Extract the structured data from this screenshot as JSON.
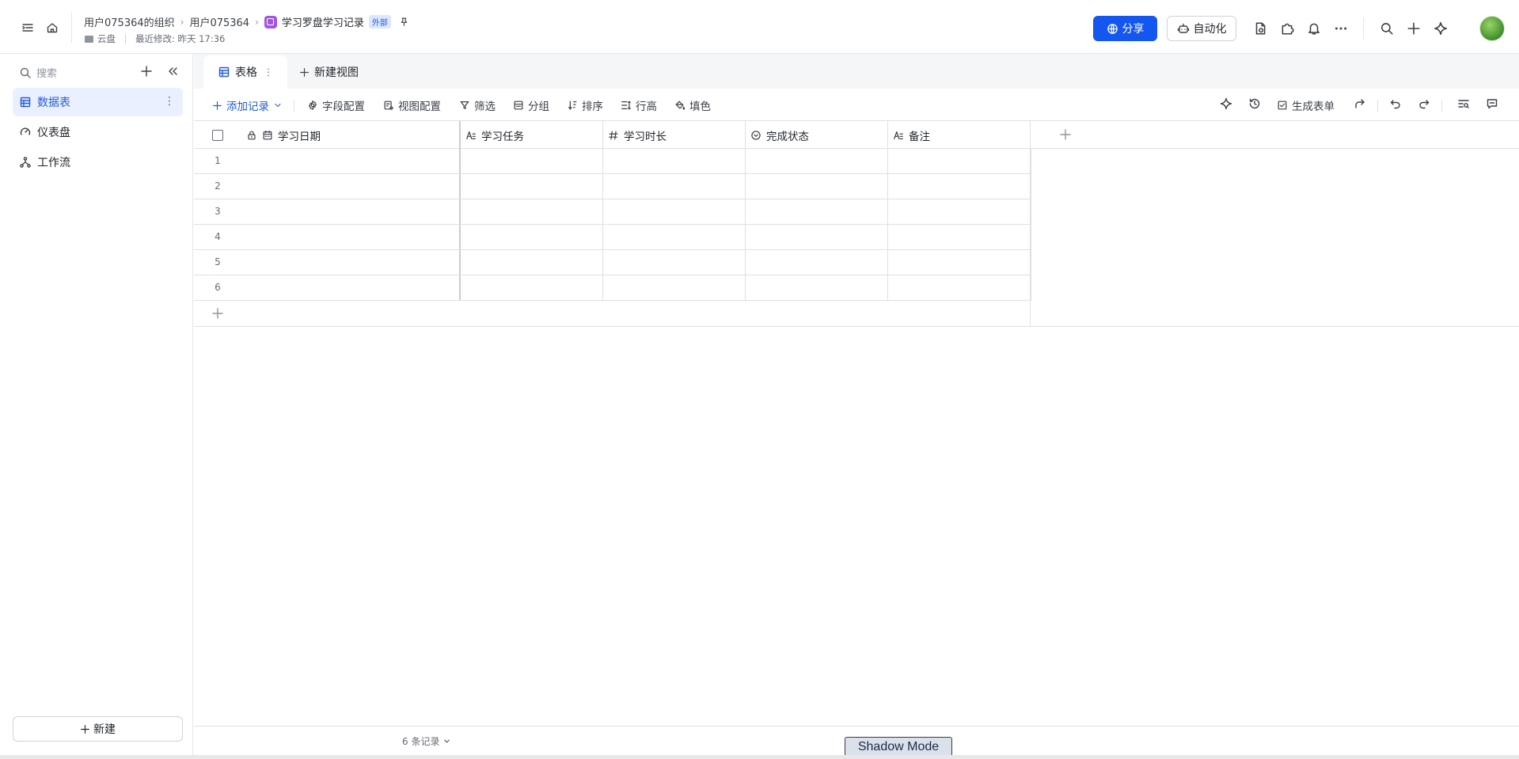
{
  "header": {
    "breadcrumbs": [
      "用户075364的组织",
      "用户075364"
    ],
    "doc_title": "学习罗盘学习记录",
    "external_badge": "外部",
    "location": "云盘",
    "last_modified": "最近修改: 昨天 17:36",
    "share_label": "分享",
    "automation_label": "自动化"
  },
  "sidebar": {
    "search_placeholder": "搜索",
    "items": [
      {
        "label": "数据表",
        "active": true
      },
      {
        "label": "仪表盘",
        "active": false
      },
      {
        "label": "工作流",
        "active": false
      }
    ],
    "new_label": "新建"
  },
  "tabs": {
    "active_label": "表格",
    "new_view_label": "新建视图"
  },
  "toolbar": {
    "add_record": "添加记录",
    "field_config": "字段配置",
    "view_config": "视图配置",
    "filter": "筛选",
    "group": "分组",
    "sort": "排序",
    "row_height": "行高",
    "fill_color": "填色",
    "generate_form": "生成表单"
  },
  "table": {
    "columns": [
      {
        "label": "学习日期",
        "type": "date"
      },
      {
        "label": "学习任务",
        "type": "text"
      },
      {
        "label": "学习时长",
        "type": "number"
      },
      {
        "label": "完成状态",
        "type": "single-select"
      },
      {
        "label": "备注",
        "type": "text"
      }
    ],
    "row_numbers": [
      "1",
      "2",
      "3",
      "4",
      "5",
      "6"
    ]
  },
  "footer": {
    "record_count": "6 条记录"
  },
  "overlay": {
    "shadow_mode": "Shadow Mode"
  },
  "colors": {
    "accent": "#1456f0",
    "active_bg": "#eaf0ff",
    "doc_icon": "#a155e7"
  }
}
